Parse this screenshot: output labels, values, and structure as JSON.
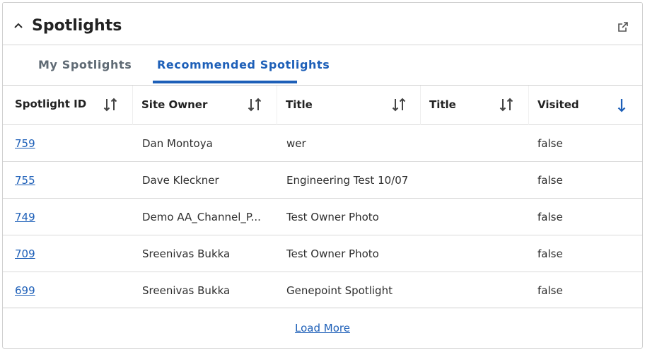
{
  "card": {
    "title": "Spotlights",
    "icons": {
      "collapse": "chevron-up-icon",
      "open_external": "external-link-icon"
    }
  },
  "tabs": [
    {
      "label": "My Spotlights",
      "active": false
    },
    {
      "label": "Recommended Spotlights",
      "active": true
    }
  ],
  "table": {
    "headers": [
      {
        "label": "Spotlight ID",
        "sort": "none"
      },
      {
        "label": "Site Owner",
        "sort": "none"
      },
      {
        "label": "Title",
        "sort": "none"
      },
      {
        "label": "Title",
        "sort": "none"
      },
      {
        "label": "Visited",
        "sort": "desc"
      }
    ],
    "rows": [
      {
        "id": "759",
        "owner": "Dan Montoya",
        "title": "wer",
        "title2": "",
        "visited": "false"
      },
      {
        "id": "755",
        "owner": "Dave Kleckner",
        "title": "Engineering Test 10/07",
        "title2": "",
        "visited": "false"
      },
      {
        "id": "749",
        "owner": "Demo AA_Channel_P...",
        "title": "Test Owner Photo",
        "title2": "",
        "visited": "false"
      },
      {
        "id": "709",
        "owner": "Sreenivas Bukka",
        "title": "Test Owner Photo",
        "title2": "",
        "visited": "false"
      },
      {
        "id": "699",
        "owner": "Sreenivas Bukka",
        "title": "Genepoint Spotlight",
        "title2": "",
        "visited": "false"
      }
    ]
  },
  "load_more_label": "Load More",
  "colors": {
    "accent": "#1d5fb8",
    "border": "#cfcfcf",
    "text": "#2b2b2b"
  }
}
